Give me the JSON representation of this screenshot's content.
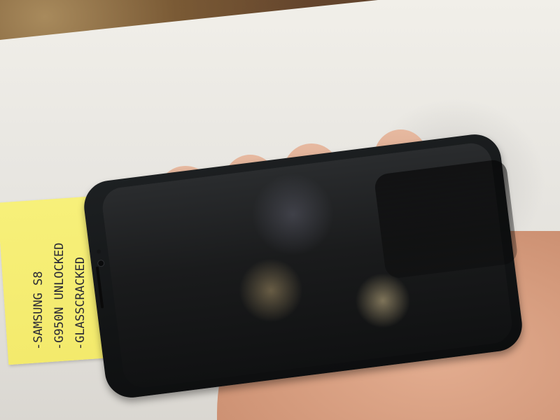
{
  "note": {
    "lines": [
      "-SAMSUNG S8",
      "-G950N UNLOCKED",
      "-GLASSCRACKED"
    ]
  },
  "colors": {
    "table": "#5a3e2a",
    "paper": "#e9e7e2",
    "sticky_note": "#f3ea6c",
    "phone_body": "#131516",
    "skin": "#d69c80"
  }
}
